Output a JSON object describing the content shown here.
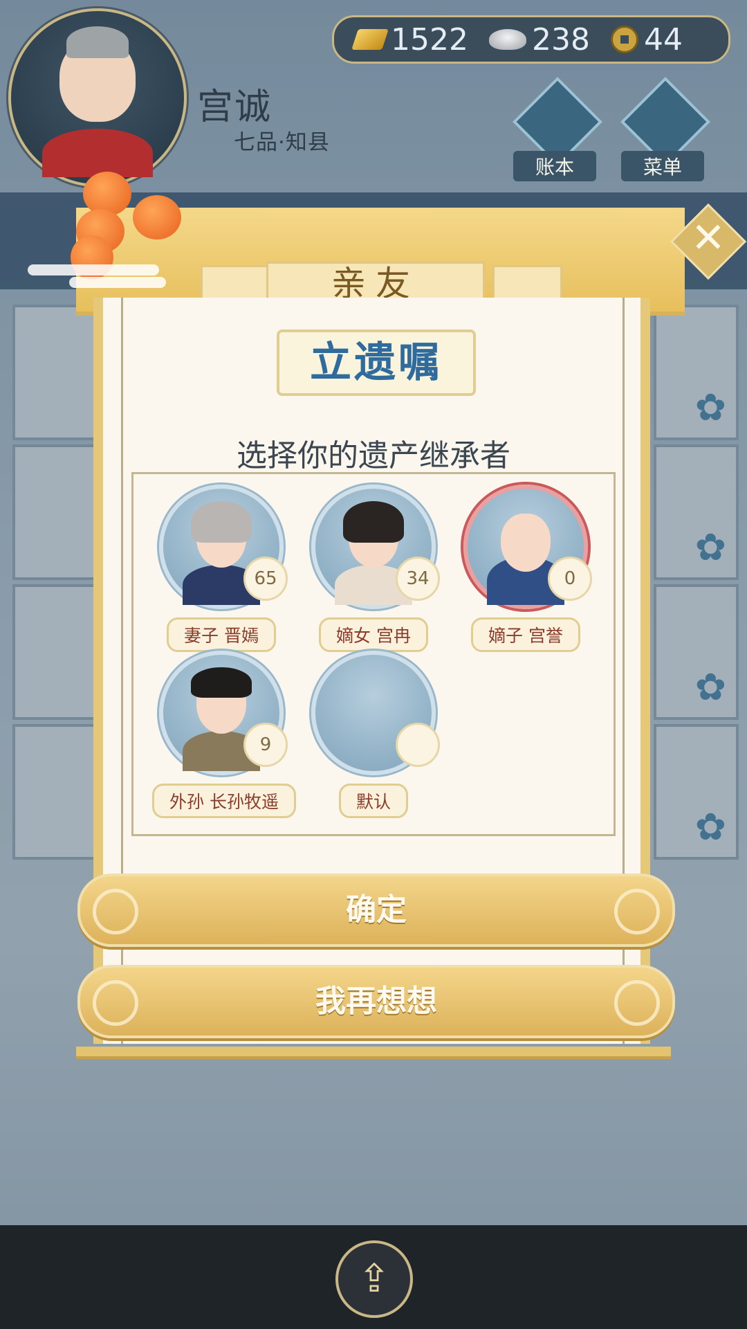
{
  "player": {
    "name": "宫诚",
    "rank": "七品·知县"
  },
  "currency": {
    "gold": "1522",
    "silver": "238",
    "coins": "44"
  },
  "hud": {
    "ledger_label": "账本",
    "menu_label": "菜单"
  },
  "dialog": {
    "tab_title": "亲友",
    "title": "立遗嘱",
    "subtitle": "选择你的遗产继承者",
    "heirs": [
      {
        "age": "65",
        "label": "妻子 晋嫣"
      },
      {
        "age": "34",
        "label": "嫡女 宫冉"
      },
      {
        "age": "0",
        "label": "嫡子 宫誉"
      },
      {
        "age": "9",
        "label": "外孙 长孙牧遥"
      },
      {
        "age": "",
        "label": "默认"
      }
    ],
    "confirm_label": "确定",
    "cancel_label": "我再想想",
    "close_glyph": "✕"
  },
  "icons": {
    "close": "close-icon",
    "share": "share-icon",
    "ledger": "ledger-icon",
    "menu": "menu-dots-icon",
    "gold": "gold-ingot-icon",
    "silver": "silver-ingot-icon",
    "coin": "copper-coin-icon"
  },
  "colors": {
    "accent_gold": "#e6c978",
    "title_blue": "#2f6b9c",
    "panel": "#fbf7ee"
  }
}
